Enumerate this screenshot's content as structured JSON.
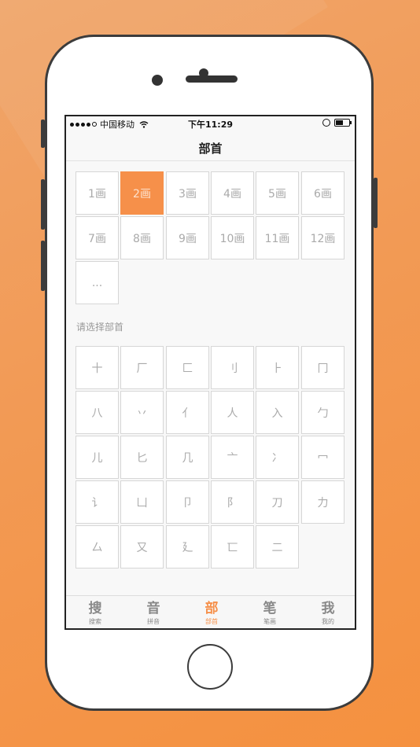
{
  "status_bar": {
    "carrier": "中国移动",
    "time": "下午11:29",
    "signal_dots": [
      true,
      true,
      true,
      true,
      false
    ]
  },
  "nav": {
    "title": "部首"
  },
  "stroke_counts": [
    "1画",
    "2画",
    "3画",
    "4画",
    "5画",
    "6画",
    "7画",
    "8画",
    "9画",
    "10画",
    "11画",
    "12画",
    "..."
  ],
  "selected_stroke": "2画",
  "section_label": "请选择部首",
  "radicals": [
    "十",
    "厂",
    "匚",
    "刂",
    "⺊",
    "冂",
    "八",
    "丷",
    "亻",
    "人",
    "入",
    "勹",
    "儿",
    "匕",
    "几",
    "亠",
    "冫",
    "冖",
    "讠",
    "凵",
    "卩",
    "阝",
    "刀",
    "力",
    "厶",
    "又",
    "廴",
    "匸",
    "二"
  ],
  "tabs": [
    {
      "icon": "搜",
      "label": "搜索",
      "active": false
    },
    {
      "icon": "音",
      "label": "拼音",
      "active": false
    },
    {
      "icon": "部",
      "label": "部首",
      "active": true
    },
    {
      "icon": "笔",
      "label": "笔画",
      "active": false
    },
    {
      "icon": "我",
      "label": "我的",
      "active": false
    }
  ],
  "colors": {
    "accent": "#f6904a",
    "background": "#f29a55"
  }
}
